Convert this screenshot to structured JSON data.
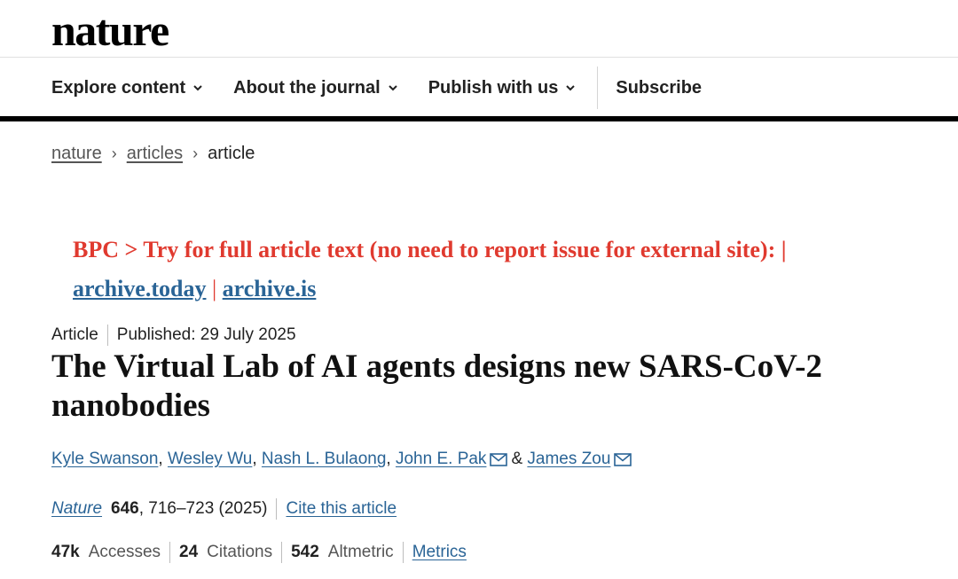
{
  "header": {
    "logo": "nature"
  },
  "nav": {
    "items": [
      {
        "label": "Explore content",
        "has_dropdown": true
      },
      {
        "label": "About the journal",
        "has_dropdown": true
      },
      {
        "label": "Publish with us",
        "has_dropdown": true
      }
    ],
    "subscribe_label": "Subscribe"
  },
  "breadcrumb": {
    "items": [
      "nature",
      "articles"
    ],
    "current": "article",
    "separator": "›"
  },
  "bpc_banner": {
    "text": "BPC > Try for full article text (no need to report issue for external site): |",
    "links": [
      "archive.today",
      "archive.is"
    ],
    "separator": "|"
  },
  "article": {
    "type": "Article",
    "published": "Published: 29 July 2025",
    "title": "The Virtual Lab of AI agents designs new SARS-CoV-2 nanobodies",
    "authors": {
      "list": [
        "Kyle Swanson",
        "Wesley Wu",
        "Nash L. Bulaong",
        "John E. Pak",
        "James Zou"
      ],
      "comma": ",",
      "ampersand": "&"
    },
    "journal": {
      "name": "Nature",
      "volume": "646",
      "pages": ", 716–723 (2025)",
      "cite_label": "Cite this article"
    },
    "metrics": {
      "accesses_value": "47k",
      "accesses_label": "Accesses",
      "citations_value": "24",
      "citations_label": "Citations",
      "altmetric_value": "542",
      "altmetric_label": "Altmetric",
      "metrics_link": "Metrics"
    }
  },
  "colors": {
    "link": "#2a6496",
    "bpc_red": "#e03a2f",
    "nav_bar": "#000000"
  }
}
